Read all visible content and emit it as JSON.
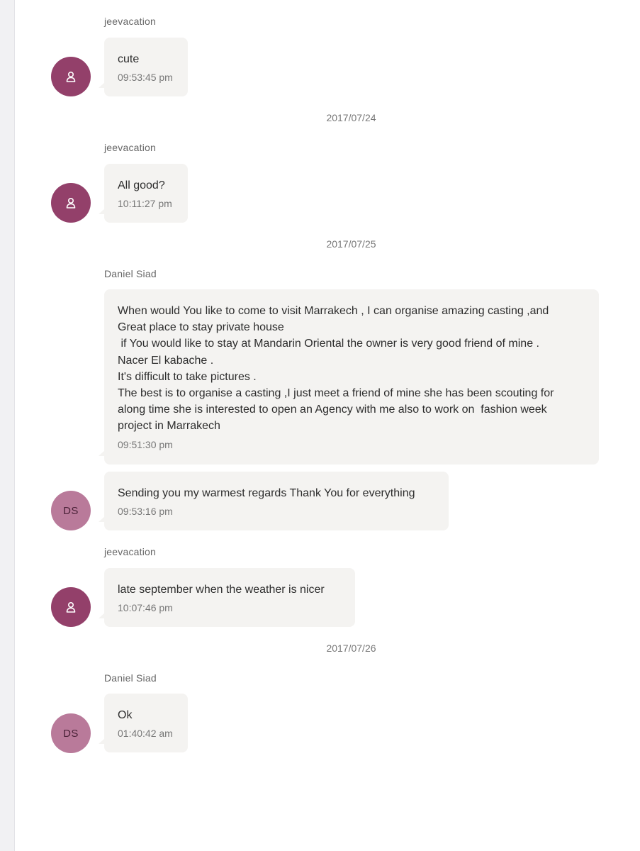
{
  "dates": [
    "2017/07/24",
    "2017/07/25",
    "2017/07/26"
  ],
  "messages": [
    {
      "sender": "jeevacation",
      "text": "cute",
      "time": "09:53:45 pm"
    },
    {
      "sender": "jeevacation",
      "text": "All good?",
      "time": "10:11:27 pm"
    },
    {
      "sender": "Daniel Siad",
      "text": "When would You like to come to visit Marrakech , I can organise amazing casting ,and\nGreat place to stay private house\n if You would like to stay at Mandarin Oriental the owner is very good friend of mine .\nNacer El kabache .\nIt's difficult to take pictures .\nThe best is to organise a casting ,I just meet a friend of mine she has been scouting for\nalong time she is interested to open an Agency with me also to work on  fashion week\nproject in Marrakech",
      "time": "09:51:30 pm"
    },
    {
      "sender": "",
      "text": "Sending you my warmest regards Thank You for everything",
      "time": "09:53:16 pm",
      "avatar_initials": "DS"
    },
    {
      "sender": "jeevacation",
      "text": "late september when the weather is nicer",
      "time": "10:07:46 pm"
    },
    {
      "sender": "Daniel Siad",
      "text": "Ok",
      "time": "01:40:42 am",
      "avatar_initials": "DS"
    }
  ],
  "icons": {
    "host_avatar": "user-icon"
  },
  "colors": {
    "host_avatar": "#93406a",
    "guest_avatar": "#b97a9a",
    "bubble": "#f4f3f1",
    "sidebar_edge": "#f1f1f3"
  }
}
